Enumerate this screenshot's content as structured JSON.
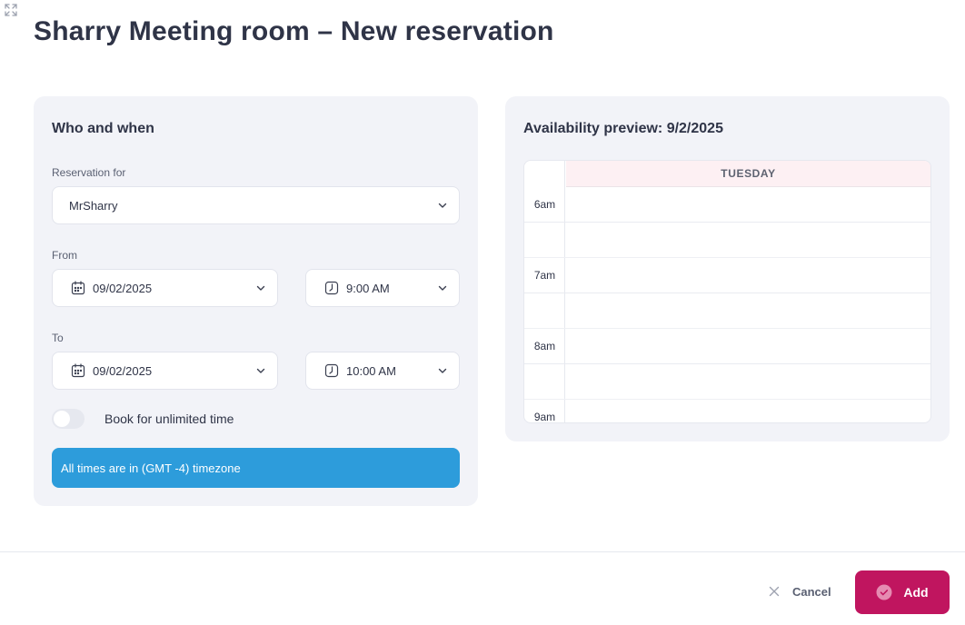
{
  "header": {
    "title": "Sharry Meeting room – New reservation",
    "expand_icon": "expand-arrows-icon"
  },
  "form": {
    "section_title": "Who and when",
    "reservation_for": {
      "label": "Reservation for",
      "value": "MrSharry"
    },
    "from": {
      "label": "From",
      "date": "09/02/2025",
      "time": "9:00 AM"
    },
    "to": {
      "label": "To",
      "date": "09/02/2025",
      "time": "10:00 AM"
    },
    "unlimited": {
      "label": "Book for unlimited time",
      "enabled": false
    },
    "timezone_note": "All times are in (GMT -4) timezone"
  },
  "preview": {
    "title": "Availability preview: 9/2/2025",
    "day": "TUESDAY",
    "hours": [
      "6am",
      "7am",
      "8am",
      "9am"
    ]
  },
  "footer": {
    "cancel_label": "Cancel",
    "add_label": "Add"
  },
  "colors": {
    "primary": "#c0155f",
    "info": "#2d9cdb",
    "card_bg": "#f2f3f8",
    "day_header_bg": "#fdf0f3"
  }
}
